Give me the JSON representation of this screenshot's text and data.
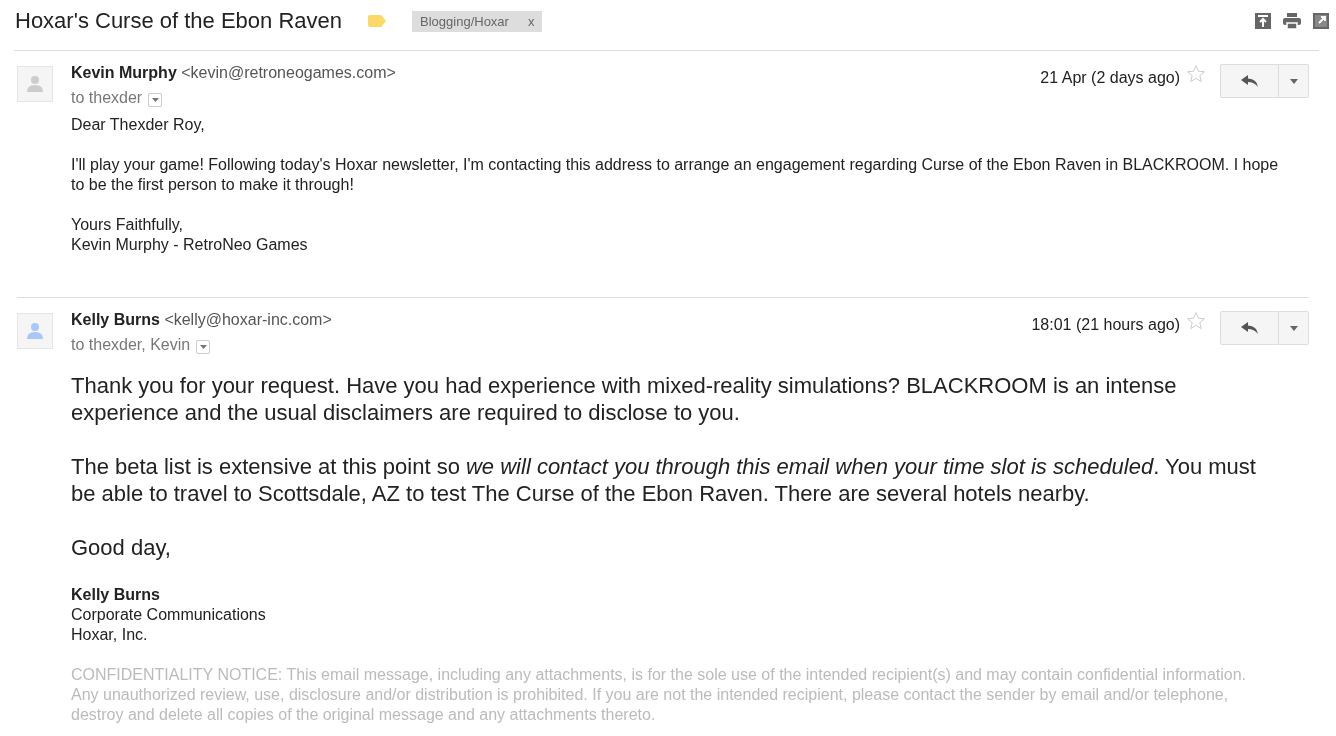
{
  "thread": {
    "subject": "Hoxar's Curse of the Ebon Raven",
    "label": "Blogging/Hoxar",
    "label_remove": "x"
  },
  "messages": [
    {
      "sender": "Kevin Murphy",
      "email": "<kevin@retroneogames.com>",
      "recipients": "to thexder",
      "date": "21 Apr (2 days ago)",
      "starred": false,
      "color": "#cccccc",
      "blocks": [
        {
          "kind": "paragraph",
          "lines": [
            "Dear Thexder Roy,"
          ]
        },
        {
          "kind": "paragraph",
          "lines": [
            "I'll play your game! Following today's Hoxar newsletter, I'm contacting this address to arrange an engagement regarding Curse of the Ebon Raven in BLACKROOM. I hope to be the first person to make it through!"
          ]
        },
        {
          "kind": "paragraph",
          "lines": [
            "Yours Faithfully,",
            "Kevin Murphy - RetroNeo Games"
          ]
        }
      ]
    },
    {
      "sender": "Kelly Burns",
      "email": "<kelly@hoxar-inc.com>",
      "recipients": "to thexder, Kevin",
      "date": "18:01 (21 hours ago)",
      "starred": false,
      "color": "#a8c7fa",
      "blocks": [
        {
          "kind": "lead",
          "lines": [
            "Thank you for your request. Have you had experience with mixed-reality simulations? BLACKROOM is an intense experience and the usual disclaimers are required to disclose to you."
          ]
        },
        {
          "kind": "lead",
          "lines": [
            "The beta list is extensive at this point so *we will contact you through this email when your time slot is scheduled*. You must be able to travel to Scottsdale, AZ to test The Curse of the Ebon Raven. There are several hotels nearby."
          ]
        },
        {
          "kind": "lead",
          "lines": [
            "Good day,"
          ]
        },
        {
          "kind": "signature",
          "lines": [
            "Kelly Burns",
            "Corporate Communications",
            "Hoxar, Inc."
          ]
        },
        {
          "kind": "notice",
          "lines": [
            "CONFIDENTIALITY NOTICE: This email message, including any attachments, is for the sole use of the intended recipient(s) and may contain confidential information. Any unauthorized review, use, disclosure and/or distribution is prohibited. If you are not the intended recipient, please contact the sender by email and/or telephone, destroy and delete all copies of the original message and any attachments thereto."
          ]
        }
      ]
    }
  ]
}
